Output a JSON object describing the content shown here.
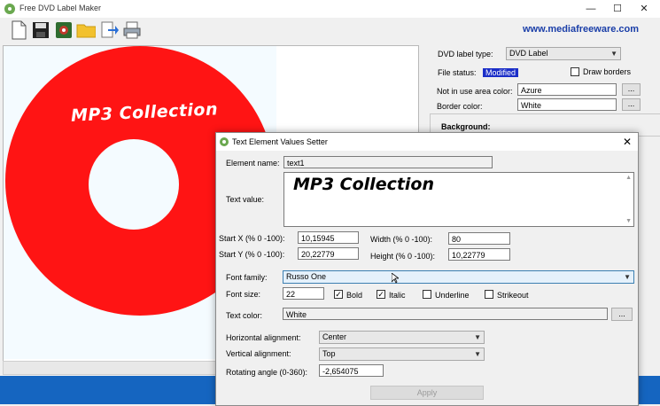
{
  "app": {
    "title": "Free DVD Label Maker",
    "website": "www.mediafreeware.com"
  },
  "window_controls": {
    "minimize": "—",
    "maximize": "☐",
    "close": "✕"
  },
  "toolbar": {
    "icons": [
      "new-document-icon",
      "save-icon",
      "export-icon",
      "open-folder-icon",
      "forward-icon",
      "print-icon"
    ]
  },
  "label": {
    "disc_text": "MP3 Collection",
    "disc_color": "#ff1414",
    "hole_color": "#f4fbff"
  },
  "right_panel": {
    "type_label": "DVD label type:",
    "type_value": "DVD Label",
    "file_status_label": "File status:",
    "file_status_value": "Modified",
    "draw_borders_label": "Draw borders",
    "not_in_use_label": "Not in use area color:",
    "not_in_use_value": "Azure",
    "border_color_label": "Border color:",
    "border_color_value": "White",
    "browse_label": "...",
    "background_label": "Background:"
  },
  "dialog": {
    "title": "Text Element Values Setter",
    "close": "✕",
    "element_name_label": "Element name:",
    "element_name_value": "text1",
    "text_value_label": "Text value:",
    "text_value": "MP3 Collection",
    "start_x_label": "Start X (% 0 -100):",
    "start_x_value": "10,15945",
    "start_y_label": "Start Y (% 0 -100):",
    "start_y_value": "20,22779",
    "width_label": "Width (% 0 -100):",
    "width_value": "80",
    "height_label": "Height (% 0 -100):",
    "height_value": "10,22779",
    "font_family_label": "Font family:",
    "font_family_value": "Russo One",
    "font_size_label": "Font size:",
    "font_size_value": "22",
    "bold_label": "Bold",
    "bold_checked": true,
    "italic_label": "Italic",
    "italic_checked": true,
    "underline_label": "Underline",
    "strikeout_label": "Strikeout",
    "text_color_label": "Text color:",
    "text_color_value": "White",
    "browse_label": "...",
    "h_align_label": "Horizontal alignment:",
    "h_align_value": "Center",
    "v_align_label": "Vertical alignment:",
    "v_align_value": "Top",
    "rotating_label": "Rotating angle (0-360):",
    "rotating_value": "-2,654075",
    "apply_label": "Apply",
    "check_mark": "✓"
  },
  "colors": {
    "accent": "#1a3ea8",
    "taskbar": "#1565c0",
    "badge": "#1b2ec8"
  }
}
